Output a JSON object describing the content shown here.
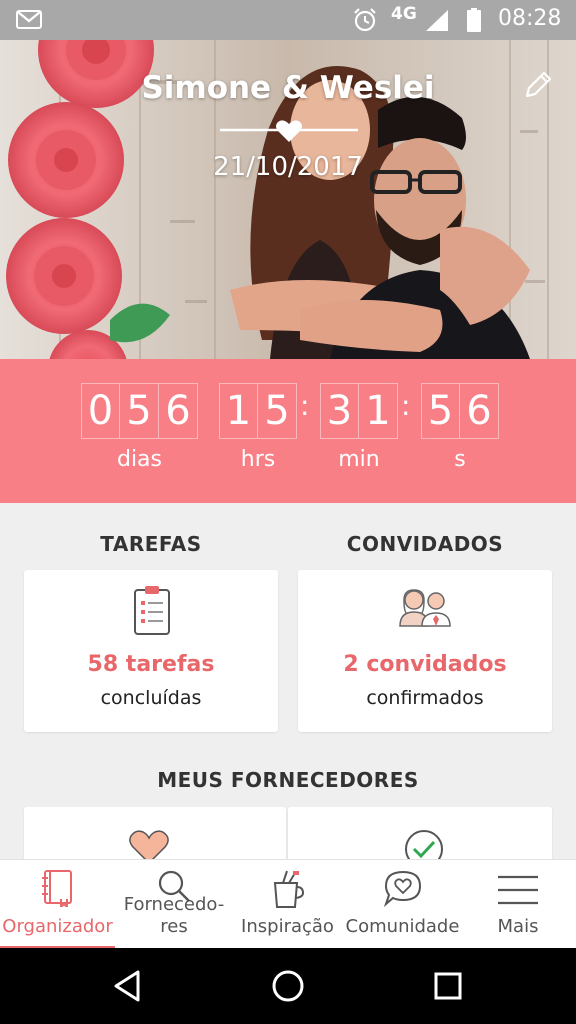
{
  "status_bar": {
    "network": "4G",
    "time": "08:28"
  },
  "hero": {
    "couple_names": "Simone & Weslei",
    "wedding_date": "21/10/2017"
  },
  "countdown": {
    "days": [
      "0",
      "5",
      "6"
    ],
    "hours": [
      "1",
      "5"
    ],
    "minutes": [
      "3",
      "1"
    ],
    "seconds": [
      "5",
      "6"
    ],
    "separator": ":",
    "labels": {
      "days": "dias",
      "hours": "hrs",
      "minutes": "min",
      "seconds": "s"
    }
  },
  "tasks": {
    "title": "TAREFAS",
    "count_label": "58 tarefas",
    "status_label": "concluídas"
  },
  "guests": {
    "title": "CONVIDADOS",
    "count_label": "2 convidados",
    "status_label": "confirmados"
  },
  "suppliers": {
    "title": "MEUS FORNECEDORES"
  },
  "bottom_nav": {
    "items": [
      {
        "label": "Organizador",
        "icon": "planner-book-icon",
        "active": true
      },
      {
        "label_line1": "Fornecedo-",
        "label_line2": "res",
        "icon": "search-icon",
        "active": false
      },
      {
        "label": "Inspiração",
        "icon": "inspiration-cup-icon",
        "active": false
      },
      {
        "label": "Comunidade",
        "icon": "chat-heart-icon",
        "active": false
      },
      {
        "label": "Mais",
        "icon": "hamburger-menu-icon",
        "active": false
      }
    ]
  },
  "colors": {
    "accent": "#f97f87",
    "accent_text": "#e8676b",
    "status_bar": "#a8a8a8",
    "background": "#efefef"
  }
}
